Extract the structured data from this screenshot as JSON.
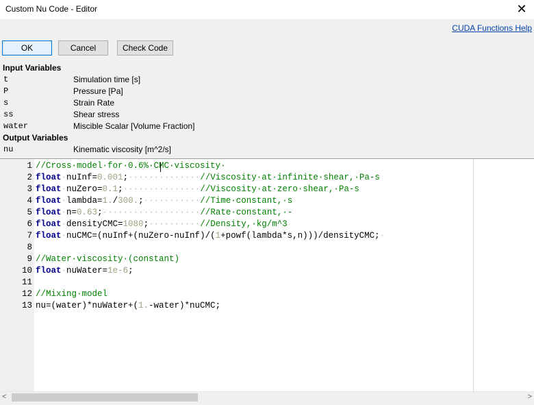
{
  "window": {
    "title": "Custom Nu Code - Editor",
    "close_glyph": "✕"
  },
  "toolbar": {
    "help_link": "CUDA Functions Help",
    "ok_label": "OK",
    "cancel_label": "Cancel",
    "check_label": "Check Code"
  },
  "input_variables": {
    "heading": "Input Variables",
    "items": [
      {
        "name": "t",
        "desc": "Simulation time [s]"
      },
      {
        "name": "P",
        "desc": "Pressure [Pa]"
      },
      {
        "name": "s",
        "desc": "Strain Rate"
      },
      {
        "name": "ss",
        "desc": "Shear stress"
      },
      {
        "name": "water",
        "desc": "Miscible Scalar [Volume Fraction]"
      }
    ]
  },
  "output_variables": {
    "heading": "Output Variables",
    "items": [
      {
        "name": "nu",
        "desc": "Kinematic viscosity [m^2/s]"
      }
    ]
  },
  "editor": {
    "lines": [
      {
        "n": "1",
        "text": "//Cross·model·for·0.6%·CMC·viscosity·"
      },
      {
        "n": "2",
        "text": "float·nuInf=0.001;··············//Viscosity·at·infinite·shear,·Pa-s"
      },
      {
        "n": "3",
        "text": "float·nuZero=0.1;···············//Viscosity·at·zero·shear,·Pa-s"
      },
      {
        "n": "4",
        "text": "float·lambda=1./300.;···········//Time·constant,·s"
      },
      {
        "n": "5",
        "text": "float·n=0.63;···················//Rate·constant,·-"
      },
      {
        "n": "6",
        "text": "float·densityCMC=1080;··········//Density,·kg/m^3"
      },
      {
        "n": "7",
        "text": "float·nuCMC=(nuInf+(nuZero-nuInf)/(1+powf(lambda*s,n)))/densityCMC;·"
      },
      {
        "n": "8",
        "text": ""
      },
      {
        "n": "9",
        "text": "//Water·viscosity·(constant)"
      },
      {
        "n": "10",
        "text": "float·nuWater=1e-6;"
      },
      {
        "n": "11",
        "text": ""
      },
      {
        "n": "12",
        "text": "//Mixing·model"
      },
      {
        "n": "13",
        "text": "nu=(water)*nuWater+(1.-water)*nuCMC;"
      }
    ]
  },
  "scrollbar": {
    "left_arrow": "<",
    "right_arrow": ">"
  },
  "colors": {
    "keyword": "#00008b",
    "comment": "#008000",
    "number": "#a0a080",
    "link": "#0645ad"
  }
}
